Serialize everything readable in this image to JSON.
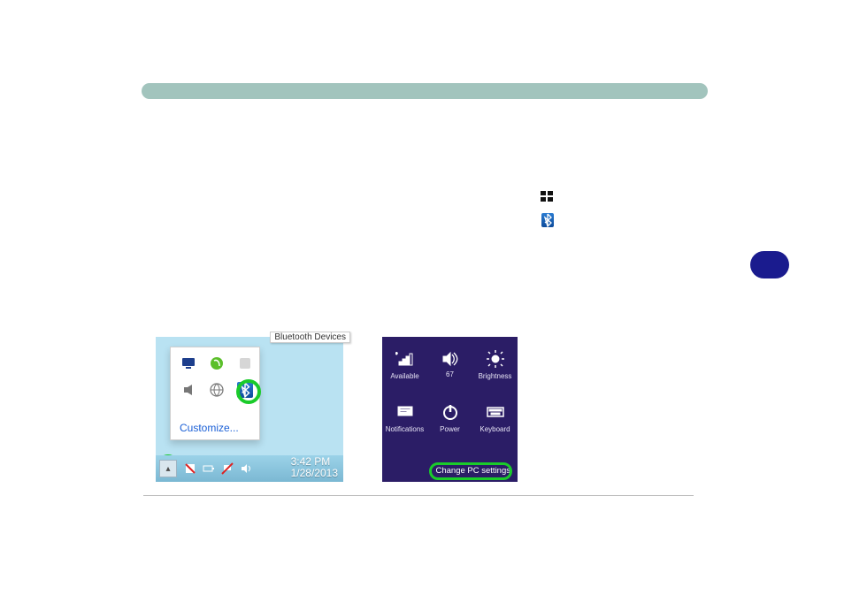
{
  "tray": {
    "tooltip": "Bluetooth Devices",
    "customize": "Customize...",
    "clock_time": "3:42 PM",
    "clock_date": "1/28/2013"
  },
  "charms": {
    "items": [
      {
        "label": "Available"
      },
      {
        "label": "67"
      },
      {
        "label": "Brightness"
      },
      {
        "label": "Notifications"
      },
      {
        "label": "Power"
      },
      {
        "label": "Keyboard"
      }
    ],
    "volume_value": "67",
    "change_pc": "Change PC settings"
  }
}
